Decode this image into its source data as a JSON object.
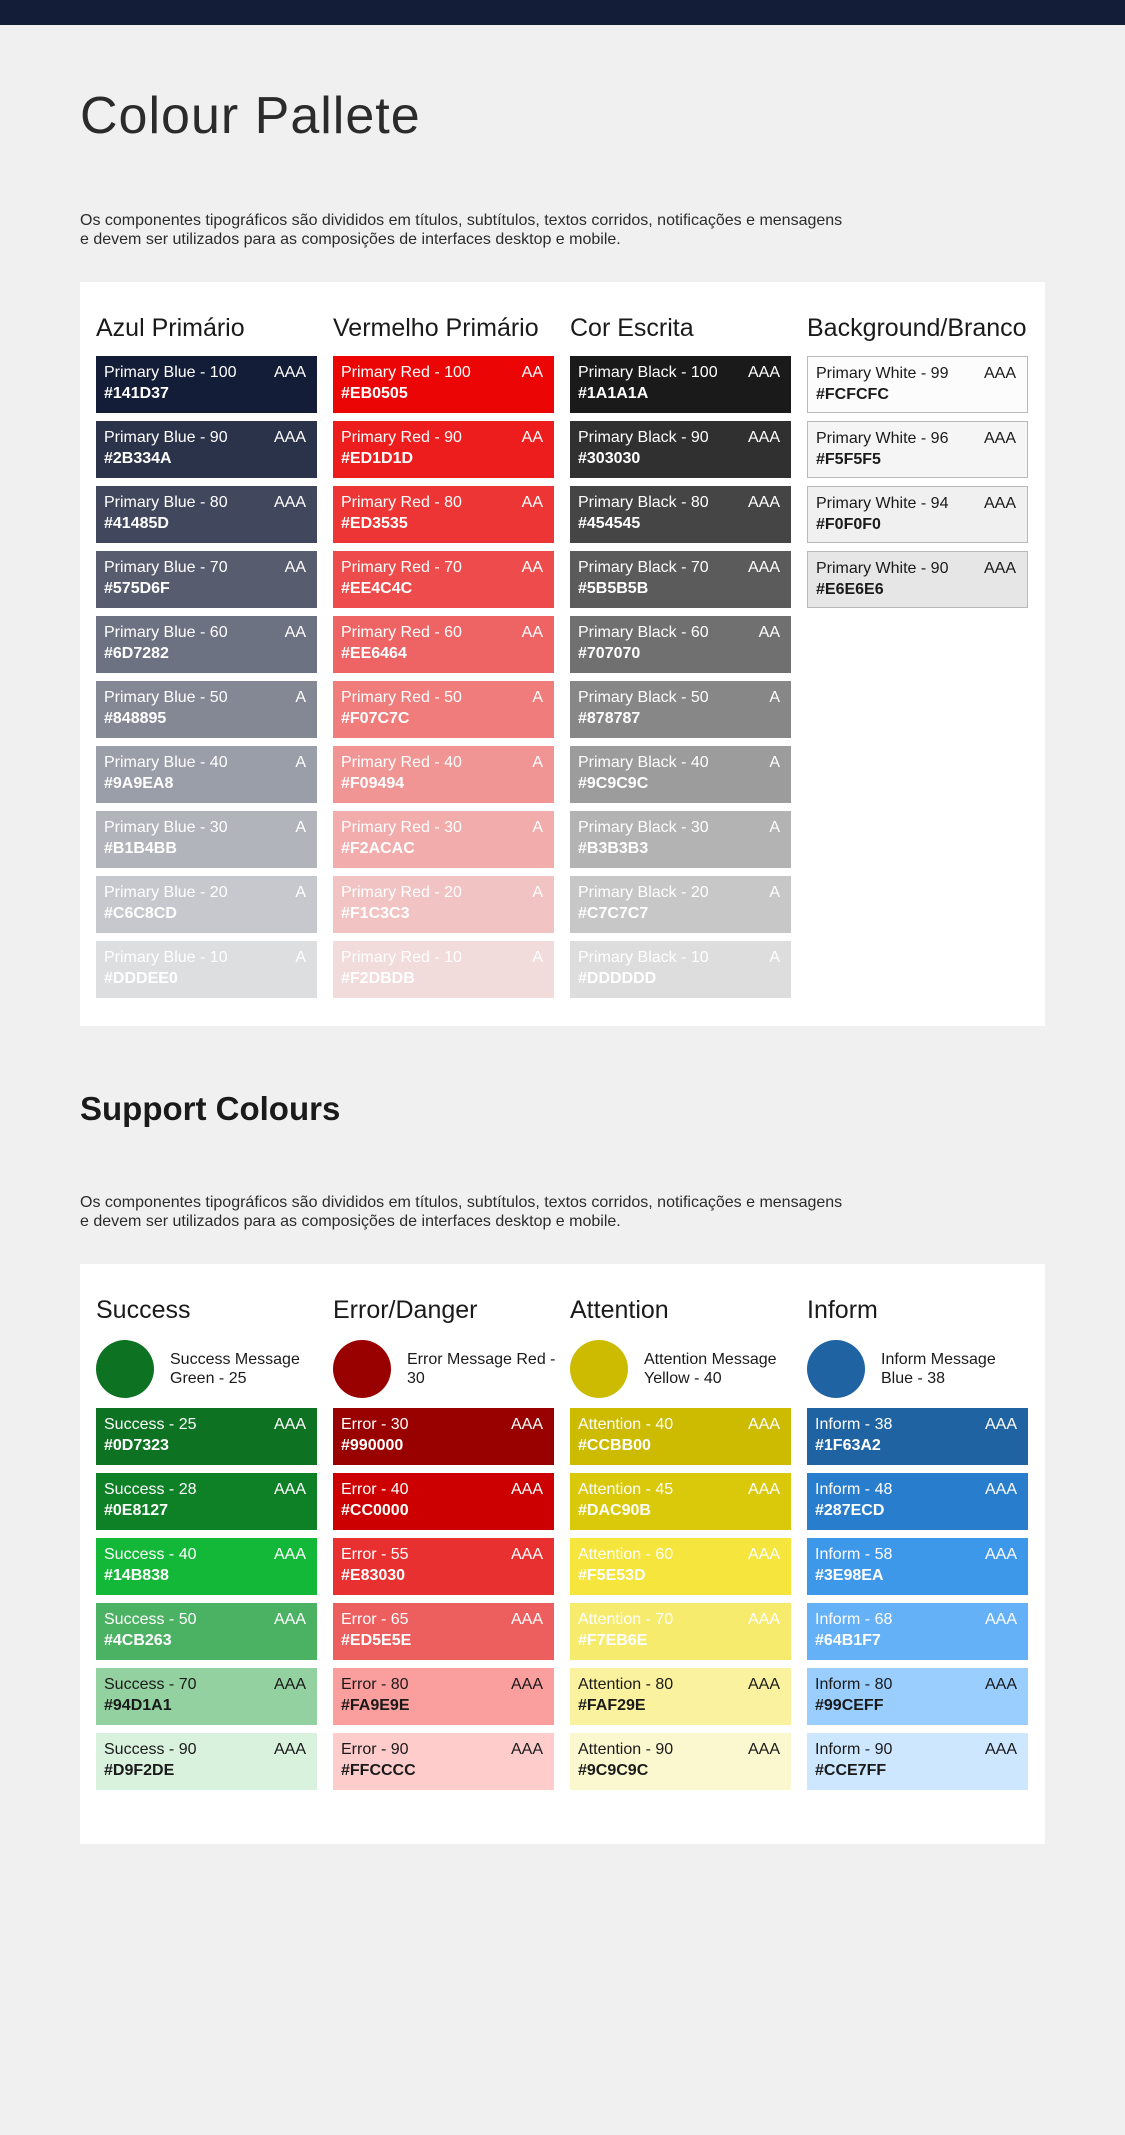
{
  "page": {
    "title": "Colour Pallete",
    "intro_line1": "Os componentes tipográficos são divididos em títulos, subtítulos, textos corridos, notificações e mensagens",
    "intro_line2": "e devem ser utilizados para as composições de interfaces desktop e mobile."
  },
  "support": {
    "title": "Support Colours",
    "intro_line1": "Os componentes tipográficos são divididos em títulos, subtítulos, textos corridos, notificações e mensagens",
    "intro_line2": "e devem ser utilizados para as composições de interfaces desktop e mobile."
  },
  "primary_groups": [
    {
      "title": "Azul Primário",
      "swatches": [
        {
          "name": "Primary Blue - 100",
          "hex": "#141D37",
          "rating": "AAA",
          "bg": "#141D37",
          "fg": "#ffffff"
        },
        {
          "name": "Primary Blue - 90",
          "hex": "#2B334A",
          "rating": "AAA",
          "bg": "#2B334A",
          "fg": "#ffffff"
        },
        {
          "name": "Primary Blue - 80",
          "hex": "#41485D",
          "rating": "AAA",
          "bg": "#41485D",
          "fg": "#ffffff"
        },
        {
          "name": "Primary Blue - 70",
          "hex": "#575D6F",
          "rating": "AA",
          "bg": "#575D6F",
          "fg": "#ffffff"
        },
        {
          "name": "Primary Blue - 60",
          "hex": "#6D7282",
          "rating": "AA",
          "bg": "#6D7282",
          "fg": "#ffffff"
        },
        {
          "name": "Primary Blue - 50",
          "hex": "#848895",
          "rating": "A",
          "bg": "#848895",
          "fg": "#ffffff"
        },
        {
          "name": "Primary Blue - 40",
          "hex": "#9A9EA8",
          "rating": "A",
          "bg": "#9A9EA8",
          "fg": "#ffffff"
        },
        {
          "name": "Primary Blue - 30",
          "hex": "#B1B4BB",
          "rating": "A",
          "bg": "#B1B4BB",
          "fg": "#ffffff"
        },
        {
          "name": "Primary Blue - 20",
          "hex": "#C6C8CD",
          "rating": "A",
          "bg": "#C6C8CD",
          "fg": "#ffffff"
        },
        {
          "name": "Primary Blue - 10",
          "hex": "#DDDEE0",
          "rating": "A",
          "bg": "#DDDEE0",
          "fg": "#ffffff"
        }
      ]
    },
    {
      "title": "Vermelho Primário",
      "swatches": [
        {
          "name": "Primary Red - 100",
          "hex": "#EB0505",
          "rating": "AA",
          "bg": "#EB0505",
          "fg": "#ffffff"
        },
        {
          "name": "Primary Red - 90",
          "hex": "#ED1D1D",
          "rating": "AA",
          "bg": "#ED1D1D",
          "fg": "#ffffff"
        },
        {
          "name": "Primary Red - 80",
          "hex": "#ED3535",
          "rating": "AA",
          "bg": "#ED3535",
          "fg": "#ffffff"
        },
        {
          "name": "Primary Red - 70",
          "hex": "#EE4C4C",
          "rating": "AA",
          "bg": "#EE4C4C",
          "fg": "#ffffff"
        },
        {
          "name": "Primary Red - 60",
          "hex": "#EE6464",
          "rating": "AA",
          "bg": "#EE6464",
          "fg": "#ffffff"
        },
        {
          "name": "Primary Red - 50",
          "hex": "#F07C7C",
          "rating": "A",
          "bg": "#F07C7C",
          "fg": "#ffffff"
        },
        {
          "name": "Primary Red - 40",
          "hex": "#F09494",
          "rating": "A",
          "bg": "#F09494",
          "fg": "#ffffff"
        },
        {
          "name": "Primary Red - 30",
          "hex": "#F2ACAC",
          "rating": "A",
          "bg": "#F2ACAC",
          "fg": "#ffffff"
        },
        {
          "name": "Primary Red - 20",
          "hex": "#F1C3C3",
          "rating": "A",
          "bg": "#F1C3C3",
          "fg": "#ffffff"
        },
        {
          "name": "Primary Red - 10",
          "hex": "#F2DBDB",
          "rating": "A",
          "bg": "#F2DBDB",
          "fg": "#ffffff"
        }
      ]
    },
    {
      "title": "Cor Escrita",
      "swatches": [
        {
          "name": "Primary Black - 100",
          "hex": "#1A1A1A",
          "rating": "AAA",
          "bg": "#1A1A1A",
          "fg": "#ffffff"
        },
        {
          "name": "Primary Black - 90",
          "hex": "#303030",
          "rating": "AAA",
          "bg": "#303030",
          "fg": "#ffffff"
        },
        {
          "name": "Primary Black - 80",
          "hex": "#454545",
          "rating": "AAA",
          "bg": "#454545",
          "fg": "#ffffff"
        },
        {
          "name": "Primary Black - 70",
          "hex": "#5B5B5B",
          "rating": "AAA",
          "bg": "#5B5B5B",
          "fg": "#ffffff"
        },
        {
          "name": "Primary Black - 60",
          "hex": "#707070",
          "rating": "AA",
          "bg": "#707070",
          "fg": "#ffffff"
        },
        {
          "name": "Primary Black - 50",
          "hex": "#878787",
          "rating": "A",
          "bg": "#878787",
          "fg": "#ffffff"
        },
        {
          "name": "Primary Black - 40",
          "hex": "#9C9C9C",
          "rating": "A",
          "bg": "#9C9C9C",
          "fg": "#ffffff"
        },
        {
          "name": "Primary Black - 30",
          "hex": "#B3B3B3",
          "rating": "A",
          "bg": "#B3B3B3",
          "fg": "#ffffff"
        },
        {
          "name": "Primary Black - 20",
          "hex": "#C7C7C7",
          "rating": "A",
          "bg": "#C7C7C7",
          "fg": "#ffffff"
        },
        {
          "name": "Primary Black - 10",
          "hex": "#DDDDDD",
          "rating": "A",
          "bg": "#DDDDDD",
          "fg": "#ffffff"
        }
      ]
    },
    {
      "title": "Background/Branco",
      "swatches": [
        {
          "name": "Primary White - 99",
          "hex": "#FCFCFC",
          "rating": "AAA",
          "bg": "#FCFCFC",
          "fg": "#1a1a1a",
          "border": true
        },
        {
          "name": "Primary White - 96",
          "hex": "#F5F5F5",
          "rating": "AAA",
          "bg": "#F5F5F5",
          "fg": "#1a1a1a",
          "border": true
        },
        {
          "name": "Primary White - 94",
          "hex": "#F0F0F0",
          "rating": "AAA",
          "bg": "#F0F0F0",
          "fg": "#1a1a1a",
          "border": true
        },
        {
          "name": "Primary White - 90",
          "hex": "#E6E6E6",
          "rating": "AAA",
          "bg": "#E6E6E6",
          "fg": "#1a1a1a",
          "border": true
        }
      ]
    }
  ],
  "support_groups": [
    {
      "title": "Success",
      "message": "Success Message Green - 25",
      "circle_color": "#0D7323",
      "swatches": [
        {
          "name": "Success - 25",
          "hex": "#0D7323",
          "rating": "AAA",
          "bg": "#0D7323",
          "fg": "#ffffff"
        },
        {
          "name": "Success - 28",
          "hex": "#0E8127",
          "rating": "AAA",
          "bg": "#0E8127",
          "fg": "#ffffff"
        },
        {
          "name": "Success - 40",
          "hex": "#14B838",
          "rating": "AAA",
          "bg": "#14B838",
          "fg": "#ffffff"
        },
        {
          "name": "Success - 50",
          "hex": "#4CB263",
          "rating": "AAA",
          "bg": "#4CB263",
          "fg": "#ffffff"
        },
        {
          "name": "Success - 70",
          "hex": "#94D1A1",
          "rating": "AAA",
          "bg": "#94D1A1",
          "fg": "#1a1a1a"
        },
        {
          "name": "Success - 90",
          "hex": "#D9F2DE",
          "rating": "AAA",
          "bg": "#D9F2DE",
          "fg": "#1a1a1a"
        }
      ]
    },
    {
      "title": "Error/Danger",
      "message": "Error Message Red - 30",
      "circle_color": "#990000",
      "swatches": [
        {
          "name": "Error - 30",
          "hex": "#990000",
          "rating": "AAA",
          "bg": "#990000",
          "fg": "#ffffff"
        },
        {
          "name": "Error - 40",
          "hex": "#CC0000",
          "rating": "AAA",
          "bg": "#CC0000",
          "fg": "#ffffff"
        },
        {
          "name": "Error - 55",
          "hex": "#E83030",
          "rating": "AAA",
          "bg": "#E83030",
          "fg": "#ffffff"
        },
        {
          "name": "Error - 65",
          "hex": "#ED5E5E",
          "rating": "AAA",
          "bg": "#ED5E5E",
          "fg": "#ffffff"
        },
        {
          "name": "Error - 80",
          "hex": "#FA9E9E",
          "rating": "AAA",
          "bg": "#FA9E9E",
          "fg": "#1a1a1a"
        },
        {
          "name": "Error - 90",
          "hex": "#FFCCCC",
          "rating": "AAA",
          "bg": "#FFCCCC",
          "fg": "#1a1a1a"
        }
      ]
    },
    {
      "title": "Attention",
      "message": "Attention Message Yellow - 40",
      "circle_color": "#CCBB00",
      "swatches": [
        {
          "name": "Attention - 40",
          "hex": "#CCBB00",
          "rating": "AAA",
          "bg": "#CCBB00",
          "fg": "#ffffff"
        },
        {
          "name": "Attention - 45",
          "hex": "#DAC90B",
          "rating": "AAA",
          "bg": "#DAC90B",
          "fg": "#ffffff"
        },
        {
          "name": "Attention - 60",
          "hex": "#F5E53D",
          "rating": "AAA",
          "bg": "#F5E53D",
          "fg": "#ffffff"
        },
        {
          "name": "Attention - 70",
          "hex": "#F7EB6E",
          "rating": "AAA",
          "bg": "#F7EB6E",
          "fg": "#ffffff"
        },
        {
          "name": "Attention - 80",
          "hex": "#FAF29E",
          "rating": "AAA",
          "bg": "#FAF29E",
          "fg": "#1a1a1a"
        },
        {
          "name": "Attention - 90",
          "hex": "#9C9C9C",
          "rating": "AAA",
          "bg": "#FBF8CF",
          "fg": "#1a1a1a"
        }
      ]
    },
    {
      "title": "Inform",
      "message": "Inform Message Blue - 38",
      "circle_color": "#1F63A2",
      "swatches": [
        {
          "name": "Inform - 38",
          "hex": "#1F63A2",
          "rating": "AAA",
          "bg": "#1F63A2",
          "fg": "#ffffff"
        },
        {
          "name": "Inform - 48",
          "hex": "#287ECD",
          "rating": "AAA",
          "bg": "#287ECD",
          "fg": "#ffffff"
        },
        {
          "name": "Inform - 58",
          "hex": "#3E98EA",
          "rating": "AAA",
          "bg": "#3E98EA",
          "fg": "#ffffff"
        },
        {
          "name": "Inform - 68",
          "hex": "#64B1F7",
          "rating": "AAA",
          "bg": "#64B1F7",
          "fg": "#ffffff"
        },
        {
          "name": "Inform - 80",
          "hex": "#99CEFF",
          "rating": "AAA",
          "bg": "#99CEFF",
          "fg": "#1a1a1a"
        },
        {
          "name": "Inform - 90",
          "hex": "#CCE7FF",
          "rating": "AAA",
          "bg": "#CCE7FF",
          "fg": "#1a1a1a"
        }
      ]
    }
  ]
}
